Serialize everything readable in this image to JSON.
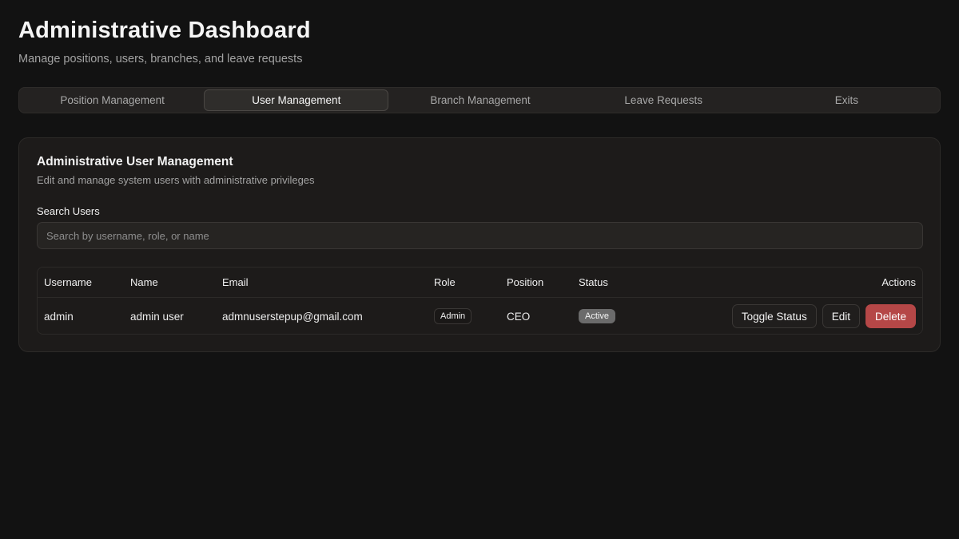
{
  "header": {
    "title": "Administrative Dashboard",
    "subtitle": "Manage positions, users, branches, and leave requests"
  },
  "tabs": [
    {
      "label": "Position Management",
      "active": false
    },
    {
      "label": "User Management",
      "active": true
    },
    {
      "label": "Branch Management",
      "active": false
    },
    {
      "label": "Leave Requests",
      "active": false
    },
    {
      "label": "Exits",
      "active": false
    }
  ],
  "card": {
    "title": "Administrative User Management",
    "description": "Edit and manage system users with administrative privileges"
  },
  "search": {
    "label": "Search Users",
    "placeholder": "Search by username, role, or name",
    "value": ""
  },
  "table": {
    "columns": [
      "Username",
      "Name",
      "Email",
      "Role",
      "Position",
      "Status",
      "Actions"
    ],
    "rows": [
      {
        "username": "admin",
        "name": "admin user",
        "email": "admnuserstepup@gmail.com",
        "role": "Admin",
        "position": "CEO",
        "status": "Active",
        "actions": {
          "toggle": "Toggle Status",
          "edit": "Edit",
          "delete": "Delete"
        }
      }
    ]
  },
  "colors": {
    "background": "#121212",
    "card": "#1d1b1a",
    "danger": "#b54747",
    "status_active": "#6b6b6b"
  }
}
